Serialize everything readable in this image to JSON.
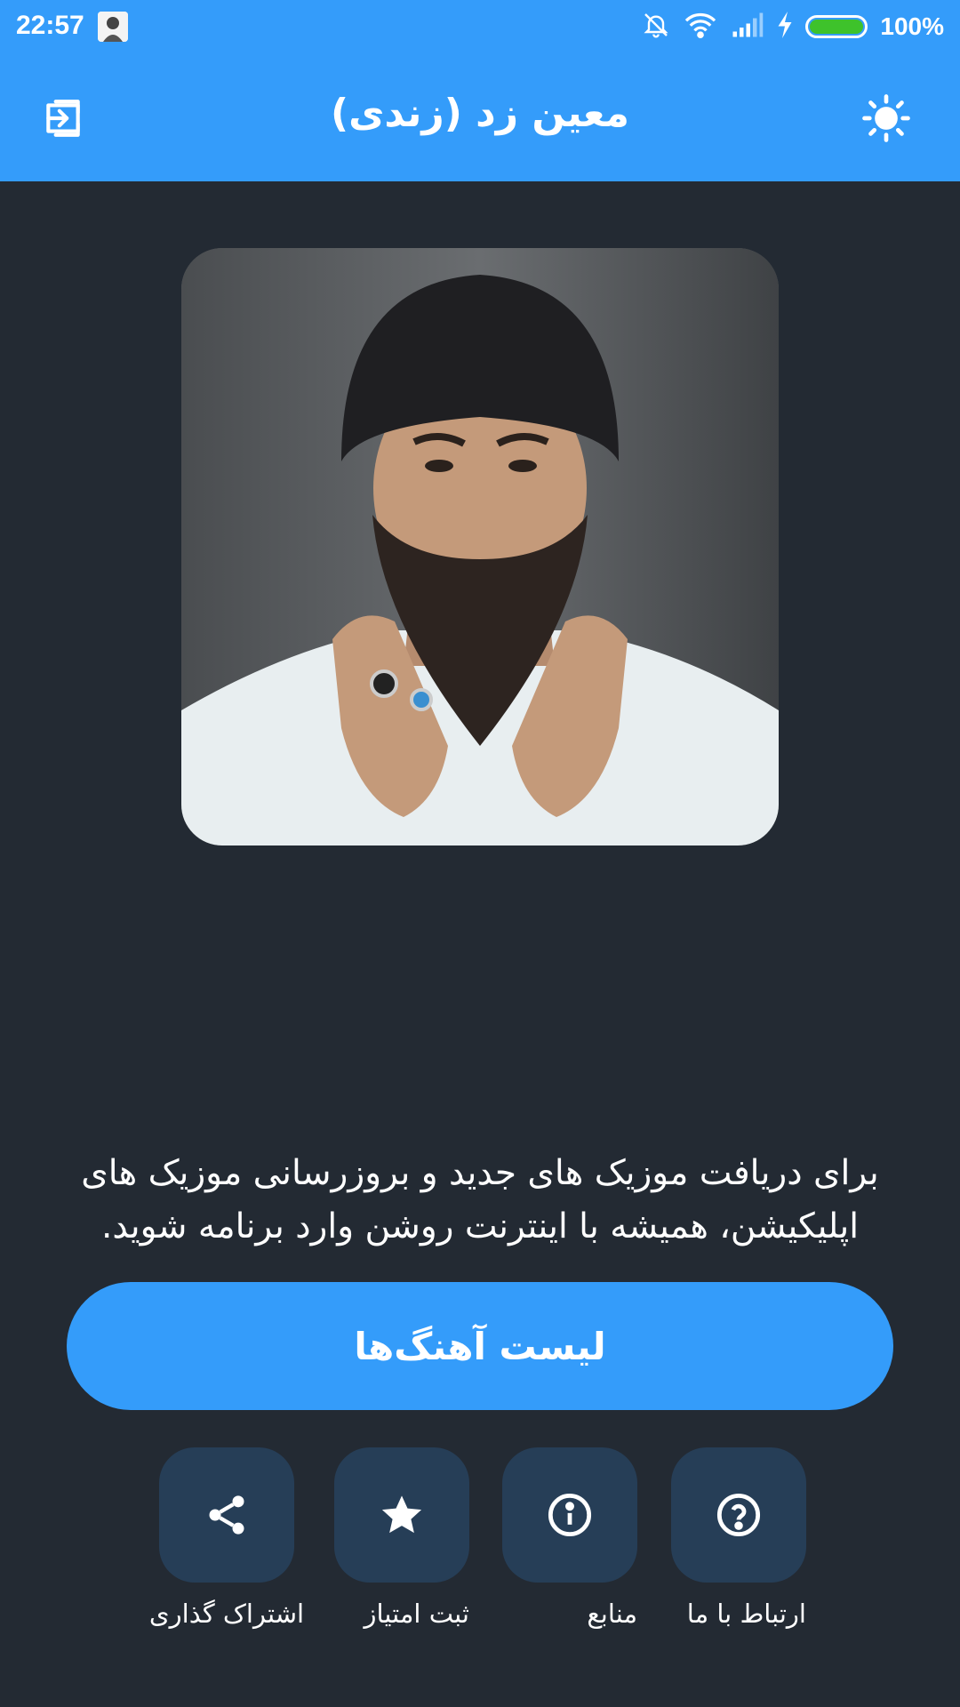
{
  "status_bar": {
    "time": "22:57",
    "battery_percent": "100%",
    "battery_level": 1.0,
    "icons": [
      "notifications-off-icon",
      "wifi-icon",
      "signal-icon",
      "charging-icon",
      "battery-icon"
    ]
  },
  "app_bar": {
    "title": "معین زد (زندی)",
    "left_icon": "exit-icon",
    "right_icon": "sun-icon"
  },
  "info_text": "برای دریافت موزیک های جدید و بروزرسانی موزیک های اپلیکیشن، همیشه با اینترنت روشن وارد برنامه شوید.",
  "songs_button": {
    "label": "لیست آهنگ‌ها"
  },
  "actions": [
    {
      "icon": "share-icon",
      "label": "اشتراک گذاری"
    },
    {
      "icon": "star-icon",
      "label": "ثبت امتیاز"
    },
    {
      "icon": "info-icon",
      "label": "منابع"
    },
    {
      "icon": "help-icon",
      "label": "ارتباط با ما"
    }
  ],
  "colors": {
    "primary": "#349cfa",
    "background": "#232a33",
    "tile": "#263e57",
    "battery": "#3ec22b"
  }
}
